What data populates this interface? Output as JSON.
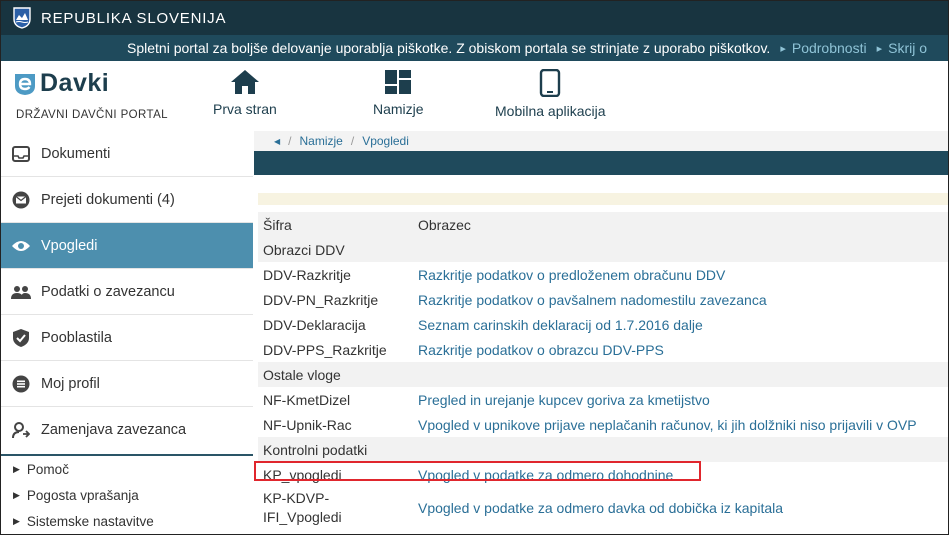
{
  "topbar": {
    "title": "REPUBLIKA SLOVENIJA",
    "crest_icon": "slovenia-crest-icon"
  },
  "cookiebar": {
    "message": "Spletni portal za boljše delovanje uporablja piškotke. Z obiskom portala se strinjate z uporabo piškotkov.",
    "details_link": "Podrobnosti",
    "hide_link": "Skrij o"
  },
  "header": {
    "logo_text": "Davki",
    "logo_subtitle": "DRŽAVNI DAVČNI PORTAL",
    "nav": [
      {
        "label": "Prva stran",
        "icon": "home-icon"
      },
      {
        "label": "Namizje",
        "icon": "dashboard-icon"
      },
      {
        "label": "Mobilna aplikacija",
        "icon": "mobile-phone-icon"
      }
    ]
  },
  "sidebar": {
    "items": [
      {
        "label": "Dokumenti",
        "icon": "inbox-icon"
      },
      {
        "label": "Prejeti dokumenti (4)",
        "icon": "envelope-icon"
      },
      {
        "label": "Vpogledi",
        "icon": "eye-icon",
        "active": true
      },
      {
        "label": "Podatki o zavezancu",
        "icon": "users-icon"
      },
      {
        "label": "Pooblastila",
        "icon": "shield-check-icon"
      },
      {
        "label": "Moj profil",
        "icon": "list-icon"
      },
      {
        "label": "Zamenjava zavezanca",
        "icon": "swap-user-icon"
      }
    ],
    "help_items": [
      {
        "label": "Pomoč"
      },
      {
        "label": "Pogosta vprašanja"
      },
      {
        "label": "Sistemske nastavitve"
      }
    ]
  },
  "breadcrumb": {
    "items": [
      "Namizje",
      "Vpogledi"
    ]
  },
  "table": {
    "headers": {
      "code": "Šifra",
      "form": "Obrazec"
    },
    "rows": [
      {
        "type": "group",
        "code": "Obrazci DDV",
        "form": ""
      },
      {
        "type": "item",
        "code": "DDV-Razkritje",
        "form": "Razkritje podatkov o predloženem obračunu DDV"
      },
      {
        "type": "item",
        "code": "DDV-PN_Razkritje",
        "form": "Razkritje podatkov o pavšalnem nadomestilu zavezanca"
      },
      {
        "type": "item",
        "code": "DDV-Deklaracija",
        "form": "Seznam carinskih deklaracij od 1.7.2016 dalje"
      },
      {
        "type": "item",
        "code": "DDV-PPS_Razkritje",
        "form": "Razkritje podatkov o obrazcu DDV-PPS"
      },
      {
        "type": "group",
        "code": "Ostale vloge",
        "form": ""
      },
      {
        "type": "item",
        "code": "NF-KmetDizel",
        "form": "Pregled in urejanje kupcev goriva za kmetijstvo"
      },
      {
        "type": "item",
        "code": "NF-Upnik-Rac",
        "form": "Vpogled v upnikove prijave neplačanih računov, ki jih dolžniki niso prijavili v OVP"
      },
      {
        "type": "group",
        "code": "Kontrolni podatki",
        "form": ""
      },
      {
        "type": "item",
        "code": "KP_vpogledi",
        "form": "Vpogled v podatke za odmero dohodnine",
        "highlighted": true
      },
      {
        "type": "item-tall",
        "code_line1": "KP-KDVP-",
        "code_line2": "IFI_Vpogledi",
        "form": "Vpogled v podatke za odmero davka od dobička iz kapitala"
      }
    ]
  },
  "colors": {
    "topbar": "#183440",
    "cookiebar": "#1f4a5c",
    "active_item": "#4d8fae",
    "link": "#2a6f97",
    "highlight_border": "#e0262d"
  }
}
